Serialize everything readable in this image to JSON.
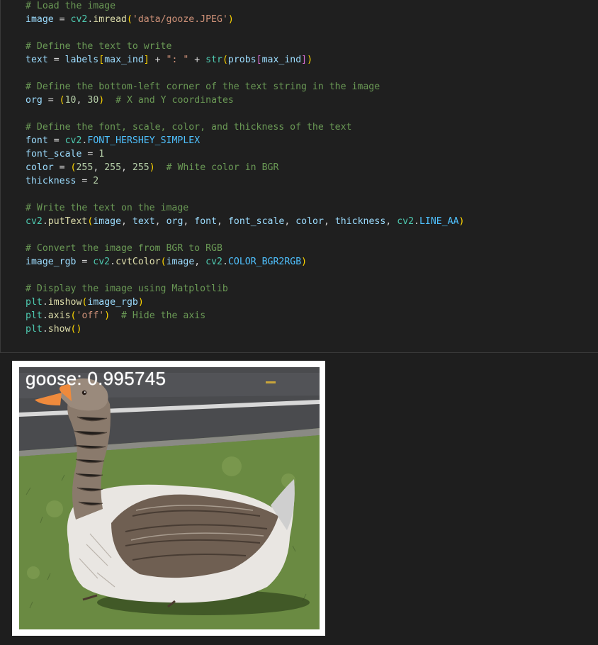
{
  "code": {
    "lines": [
      [
        {
          "c": "cm",
          "t": "# Load the image"
        }
      ],
      [
        {
          "c": "vr",
          "t": "image"
        },
        {
          "c": "op",
          "t": " = "
        },
        {
          "c": "bi",
          "t": "cv2"
        },
        {
          "c": "op",
          "t": "."
        },
        {
          "c": "fn",
          "t": "imread"
        },
        {
          "c": "bq",
          "t": "("
        },
        {
          "c": "st",
          "t": "'data/gooze.JPEG'"
        },
        {
          "c": "bq",
          "t": ")"
        }
      ],
      [],
      [
        {
          "c": "cm",
          "t": "# Define the text to write"
        }
      ],
      [
        {
          "c": "vr",
          "t": "text"
        },
        {
          "c": "op",
          "t": " = "
        },
        {
          "c": "vr",
          "t": "labels"
        },
        {
          "c": "bq",
          "t": "["
        },
        {
          "c": "vr",
          "t": "max_ind"
        },
        {
          "c": "bq",
          "t": "]"
        },
        {
          "c": "op",
          "t": " + "
        },
        {
          "c": "st",
          "t": "\": \""
        },
        {
          "c": "op",
          "t": " + "
        },
        {
          "c": "bi",
          "t": "str"
        },
        {
          "c": "bq",
          "t": "("
        },
        {
          "c": "vr",
          "t": "probs"
        },
        {
          "c": "bp",
          "t": "["
        },
        {
          "c": "vr",
          "t": "max_ind"
        },
        {
          "c": "bp",
          "t": "]"
        },
        {
          "c": "bq",
          "t": ")"
        }
      ],
      [],
      [
        {
          "c": "cm",
          "t": "# Define the bottom-left corner of the text string in the image"
        }
      ],
      [
        {
          "c": "vr",
          "t": "org"
        },
        {
          "c": "op",
          "t": " = "
        },
        {
          "c": "bq",
          "t": "("
        },
        {
          "c": "nm",
          "t": "10"
        },
        {
          "c": "op",
          "t": ", "
        },
        {
          "c": "nm",
          "t": "30"
        },
        {
          "c": "bq",
          "t": ")"
        },
        {
          "c": "op",
          "t": "  "
        },
        {
          "c": "cm",
          "t": "# X and Y coordinates"
        }
      ],
      [],
      [
        {
          "c": "cm",
          "t": "# Define the font, scale, color, and thickness of the text"
        }
      ],
      [
        {
          "c": "vr",
          "t": "font"
        },
        {
          "c": "op",
          "t": " = "
        },
        {
          "c": "bi",
          "t": "cv2"
        },
        {
          "c": "op",
          "t": "."
        },
        {
          "c": "cn",
          "t": "FONT_HERSHEY_SIMPLEX"
        }
      ],
      [
        {
          "c": "vr",
          "t": "font_scale"
        },
        {
          "c": "op",
          "t": " = "
        },
        {
          "c": "nm",
          "t": "1"
        }
      ],
      [
        {
          "c": "vr",
          "t": "color"
        },
        {
          "c": "op",
          "t": " = "
        },
        {
          "c": "bq",
          "t": "("
        },
        {
          "c": "nm",
          "t": "255"
        },
        {
          "c": "op",
          "t": ", "
        },
        {
          "c": "nm",
          "t": "255"
        },
        {
          "c": "op",
          "t": ", "
        },
        {
          "c": "nm",
          "t": "255"
        },
        {
          "c": "bq",
          "t": ")"
        },
        {
          "c": "op",
          "t": "  "
        },
        {
          "c": "cm",
          "t": "# White color in BGR"
        }
      ],
      [
        {
          "c": "vr",
          "t": "thickness"
        },
        {
          "c": "op",
          "t": " = "
        },
        {
          "c": "nm",
          "t": "2"
        }
      ],
      [],
      [
        {
          "c": "cm",
          "t": "# Write the text on the image"
        }
      ],
      [
        {
          "c": "bi",
          "t": "cv2"
        },
        {
          "c": "op",
          "t": "."
        },
        {
          "c": "fn",
          "t": "putText"
        },
        {
          "c": "bq",
          "t": "("
        },
        {
          "c": "vr",
          "t": "image"
        },
        {
          "c": "op",
          "t": ", "
        },
        {
          "c": "vr",
          "t": "text"
        },
        {
          "c": "op",
          "t": ", "
        },
        {
          "c": "vr",
          "t": "org"
        },
        {
          "c": "op",
          "t": ", "
        },
        {
          "c": "vr",
          "t": "font"
        },
        {
          "c": "op",
          "t": ", "
        },
        {
          "c": "vr",
          "t": "font_scale"
        },
        {
          "c": "op",
          "t": ", "
        },
        {
          "c": "vr",
          "t": "color"
        },
        {
          "c": "op",
          "t": ", "
        },
        {
          "c": "vr",
          "t": "thickness"
        },
        {
          "c": "op",
          "t": ", "
        },
        {
          "c": "bi",
          "t": "cv2"
        },
        {
          "c": "op",
          "t": "."
        },
        {
          "c": "cn",
          "t": "LINE_AA"
        },
        {
          "c": "bq",
          "t": ")"
        }
      ],
      [],
      [
        {
          "c": "cm",
          "t": "# Convert the image from BGR to RGB"
        }
      ],
      [
        {
          "c": "vr",
          "t": "image_rgb"
        },
        {
          "c": "op",
          "t": " = "
        },
        {
          "c": "bi",
          "t": "cv2"
        },
        {
          "c": "op",
          "t": "."
        },
        {
          "c": "fn",
          "t": "cvtColor"
        },
        {
          "c": "bq",
          "t": "("
        },
        {
          "c": "vr",
          "t": "image"
        },
        {
          "c": "op",
          "t": ", "
        },
        {
          "c": "bi",
          "t": "cv2"
        },
        {
          "c": "op",
          "t": "."
        },
        {
          "c": "cn",
          "t": "COLOR_BGR2RGB"
        },
        {
          "c": "bq",
          "t": ")"
        }
      ],
      [],
      [
        {
          "c": "cm",
          "t": "# Display the image using Matplotlib"
        }
      ],
      [
        {
          "c": "bi",
          "t": "plt"
        },
        {
          "c": "op",
          "t": "."
        },
        {
          "c": "fn",
          "t": "imshow"
        },
        {
          "c": "bq",
          "t": "("
        },
        {
          "c": "vr",
          "t": "image_rgb"
        },
        {
          "c": "bq",
          "t": ")"
        }
      ],
      [
        {
          "c": "bi",
          "t": "plt"
        },
        {
          "c": "op",
          "t": "."
        },
        {
          "c": "fn",
          "t": "axis"
        },
        {
          "c": "bq",
          "t": "("
        },
        {
          "c": "st",
          "t": "'off'"
        },
        {
          "c": "bq",
          "t": ")"
        },
        {
          "c": "op",
          "t": "  "
        },
        {
          "c": "cm",
          "t": "# Hide the axis"
        }
      ],
      [
        {
          "c": "bi",
          "t": "plt"
        },
        {
          "c": "op",
          "t": "."
        },
        {
          "c": "fn",
          "t": "show"
        },
        {
          "c": "bq",
          "t": "()"
        }
      ]
    ]
  },
  "output": {
    "overlay_label": "goose: 0.995745"
  },
  "colors": {
    "editor_bg": "#1f1f1f",
    "comment": "#6a9955",
    "variable": "#9cdcfe",
    "function": "#dcdcaa",
    "string": "#ce9178",
    "number": "#b5cea8",
    "bracket": "#ffd700",
    "constant": "#4fc1ff"
  }
}
